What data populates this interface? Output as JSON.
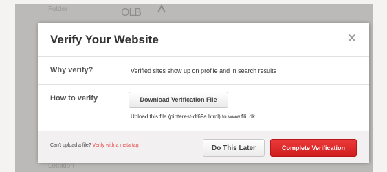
{
  "background": {
    "label_top": "Folder",
    "label_bottom": "Location",
    "logo_text": "OLB"
  },
  "modal": {
    "title": "Verify Your Website",
    "close_icon": "close-icon",
    "why": {
      "label": "Why verify?",
      "text": "Verified sites show up on profile and in search results"
    },
    "how": {
      "label": "How to verify",
      "download_button": "Download Verification File",
      "upload_hint": "Upload this file (pinterest-df69a.html) to www.filii.dk"
    },
    "footer": {
      "cant_upload": "Can't upload a file?",
      "meta_link": "Verify with a meta tag",
      "later_button": "Do This Later",
      "complete_button": "Complete Verification"
    }
  },
  "colors": {
    "accent_red": "#e3292b",
    "title_text": "#333333",
    "footer_bg": "#f2f0f0"
  }
}
